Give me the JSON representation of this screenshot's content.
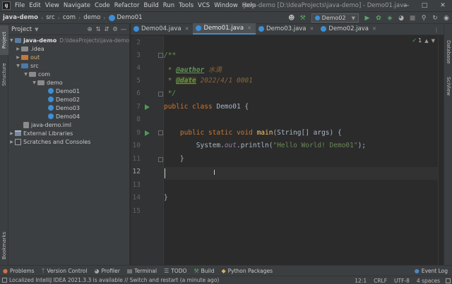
{
  "menubar": {
    "logo": "IJ",
    "items": [
      "File",
      "Edit",
      "View",
      "Navigate",
      "Code",
      "Refactor",
      "Build",
      "Run",
      "Tools",
      "VCS",
      "Window",
      "Help"
    ],
    "window_title": "java-demo [D:\\IdeaProjects\\java-demo] - Demo01.java"
  },
  "navbar": {
    "breadcrumb": [
      "java-demo",
      "src",
      "com",
      "demo",
      "Demo01"
    ],
    "run_config": "Demo02"
  },
  "left_strip": {
    "tabs": [
      "Project",
      "Structure",
      "Bookmarks"
    ]
  },
  "right_strip": {
    "tabs": [
      "Database",
      "SciView"
    ]
  },
  "project_panel": {
    "title": "Project",
    "tree": {
      "root_name": "java-demo",
      "root_path": "D:\\IdeaProjects\\java-demo",
      "idea": ".idea",
      "out": "out",
      "src": "src",
      "com": "com",
      "demo": "demo",
      "files": [
        "Demo01",
        "Demo02",
        "Demo03",
        "Demo04"
      ],
      "iml": "java-demo.iml",
      "external_libraries": "External Libraries",
      "scratches": "Scratches and Consoles"
    }
  },
  "tabs": [
    {
      "label": "Demo04.java",
      "active": false
    },
    {
      "label": "Demo01.java",
      "active": true
    },
    {
      "label": "Demo03.java",
      "active": false
    },
    {
      "label": "Demo02.java",
      "active": false
    }
  ],
  "editor": {
    "line_numbers": [
      "2",
      "3",
      "4",
      "5",
      "6",
      "7",
      "8",
      "9",
      "10",
      "11",
      "12",
      "13",
      "14",
      "15"
    ],
    "current_line": "12",
    "status_count": "1",
    "code": {
      "l3_comment_open": "/**",
      "l4_star": " * ",
      "l4_tag": "@author",
      "l4_value": " 水滴",
      "l5_star": " * ",
      "l5_tag": "@date",
      "l5_value": " 2022/4/1 0001",
      "l6_close": " */",
      "l7_kw": "public class ",
      "l7_name": "Demo01 {",
      "l9_indent": "    ",
      "l9_kw": "public static void ",
      "l9_fn": "main",
      "l9_rest": "(String[] args) {",
      "l10_indent": "        ",
      "l10_a": "System.",
      "l10_out": "out",
      "l10_b": ".println(",
      "l10_str": "\"Hello World! Demo01\"",
      "l10_c": ");",
      "l11": "    }",
      "l14": "}"
    }
  },
  "bottom_tools": {
    "problems": "Problems",
    "version_control": "Version Control",
    "profiler": "Profiler",
    "terminal": "Terminal",
    "todo": "TODO",
    "build": "Build",
    "python_packages": "Python Packages",
    "event_log": "Event Log"
  },
  "status_bar": {
    "message": "Localized IntelliJ IDEA 2021.3.3 is available // Switch and restart (a minute ago)",
    "position": "12:1",
    "line_sep": "CRLF",
    "encoding": "UTF-8",
    "indent": "4 spaces"
  }
}
